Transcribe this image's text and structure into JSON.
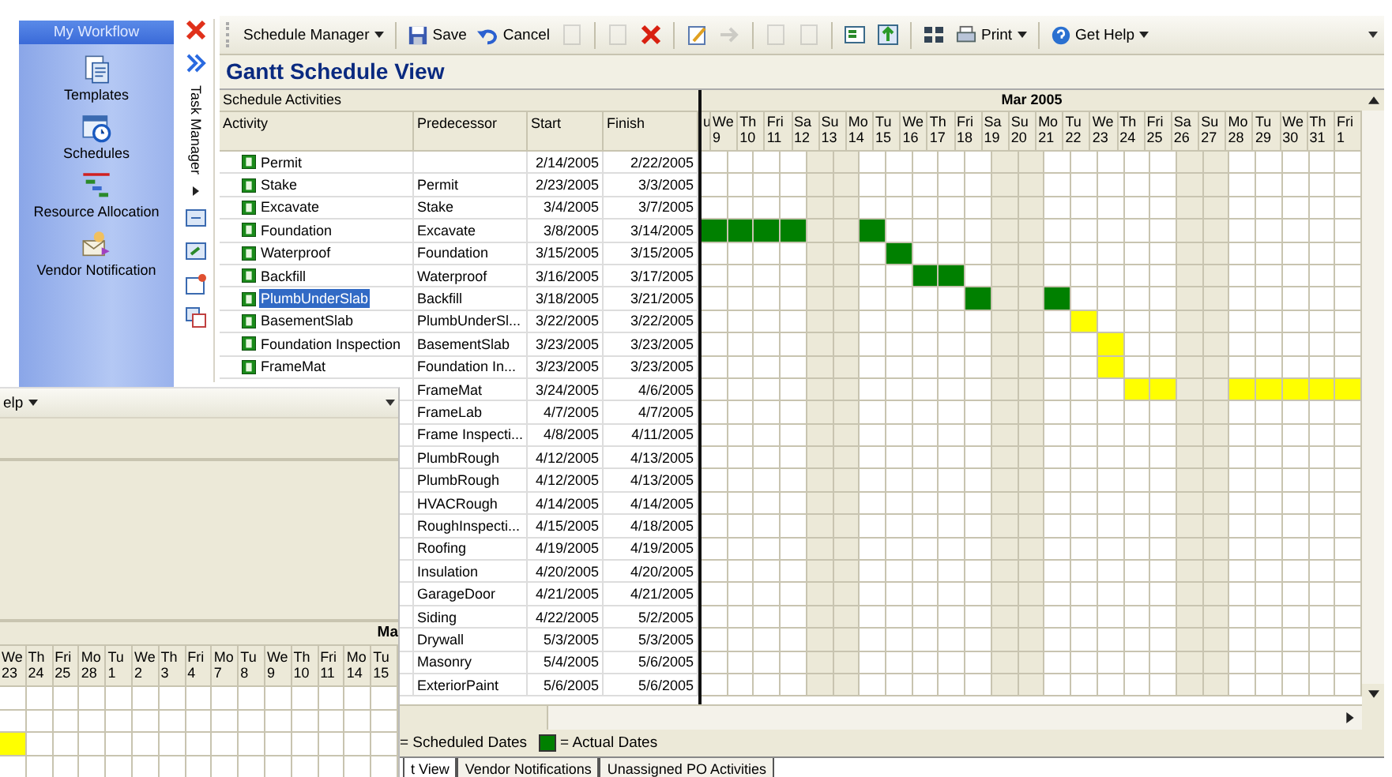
{
  "sidebar": {
    "title": "My Workflow",
    "items": [
      {
        "label": "Templates"
      },
      {
        "label": "Schedules"
      },
      {
        "label": "Resource Allocation"
      },
      {
        "label": "Vendor Notification"
      }
    ]
  },
  "task_strip": {
    "label": "Task Manager"
  },
  "toolbar": [
    {
      "kind": "menu",
      "label": "Schedule Manager"
    },
    {
      "kind": "sep"
    },
    {
      "kind": "button",
      "label": "Save",
      "disabled": false
    },
    {
      "kind": "button",
      "label": "Cancel",
      "disabled": false
    },
    {
      "kind": "icon",
      "disabled": true
    },
    {
      "kind": "sep"
    },
    {
      "kind": "icon",
      "disabled": true
    },
    {
      "kind": "icon",
      "disabled": false
    },
    {
      "kind": "sep"
    },
    {
      "kind": "icon",
      "disabled": false
    },
    {
      "kind": "icon",
      "disabled": true
    },
    {
      "kind": "sep"
    },
    {
      "kind": "icon",
      "disabled": true
    },
    {
      "kind": "icon",
      "disabled": true
    },
    {
      "kind": "sep"
    },
    {
      "kind": "icon",
      "disabled": false
    },
    {
      "kind": "icon",
      "disabled": false
    },
    {
      "kind": "sep"
    },
    {
      "kind": "icon",
      "disabled": false
    },
    {
      "kind": "menu",
      "label": "Print"
    },
    {
      "kind": "sep"
    },
    {
      "kind": "menu",
      "label": "Get Help"
    }
  ],
  "title": "Gantt Schedule View",
  "table": {
    "caption": "Schedule Activities",
    "columns": [
      "Activity",
      "Predecessor",
      "Start",
      "Finish"
    ],
    "rows": [
      {
        "activity": "Permit",
        "start": "2/14/2005",
        "finish": "2/22/2005",
        "selected": false
      },
      {
        "activity": "Stake",
        "predecessor": "Permit",
        "start": "2/23/2005",
        "finish": "3/3/2005",
        "selected": false
      },
      {
        "activity": "Excavate",
        "predecessor": "Stake",
        "start": "3/4/2005",
        "finish": "3/7/2005",
        "selected": false
      },
      {
        "activity": "Foundation",
        "predecessor": "Excavate",
        "start": "3/8/2005",
        "finish": "3/14/2005",
        "selected": false,
        "days": [
          {
            "kind": "actual"
          },
          {
            "kind": "actual"
          },
          {
            "kind": "actual"
          },
          {
            "kind": "actual"
          },
          {
            "kind": "empty"
          },
          {
            "kind": "empty"
          },
          {
            "kind": "actual"
          }
        ]
      },
      {
        "activity": "Waterproof",
        "predecessor": "Foundation",
        "start": "3/15/2005",
        "finish": "3/15/2005",
        "selected": false,
        "days": [
          {
            "kind": "empty"
          },
          {
            "kind": "empty"
          },
          {
            "kind": "empty"
          },
          {
            "kind": "empty"
          },
          {
            "kind": "empty"
          },
          {
            "kind": "empty"
          },
          {
            "kind": "empty"
          },
          {
            "kind": "actual"
          }
        ]
      },
      {
        "activity": "Backfill",
        "predecessor": "Waterproof",
        "start": "3/16/2005",
        "finish": "3/17/2005",
        "selected": false,
        "days": [
          {
            "kind": "empty"
          },
          {
            "kind": "empty"
          },
          {
            "kind": "empty"
          },
          {
            "kind": "empty"
          },
          {
            "kind": "empty"
          },
          {
            "kind": "empty"
          },
          {
            "kind": "empty"
          },
          {
            "kind": "empty"
          },
          {
            "kind": "actual"
          },
          {
            "kind": "actual"
          }
        ]
      },
      {
        "activity": "PlumbUnderSlab",
        "predecessor": "Backfill",
        "start": "3/18/2005",
        "finish": "3/21/2005",
        "selected": true,
        "days": [
          {
            "kind": "empty"
          },
          {
            "kind": "empty"
          },
          {
            "kind": "empty"
          },
          {
            "kind": "empty"
          },
          {
            "kind": "empty"
          },
          {
            "kind": "empty"
          },
          {
            "kind": "empty"
          },
          {
            "kind": "empty"
          },
          {
            "kind": "empty"
          },
          {
            "kind": "empty"
          },
          {
            "kind": "actual"
          },
          {
            "kind": "empty"
          },
          {
            "kind": "empty"
          },
          {
            "kind": "actual"
          }
        ]
      },
      {
        "activity": "BasementSlab",
        "predecessor": "PlumbUnderSl...",
        "start": "3/22/2005",
        "finish": "3/22/2005",
        "selected": false,
        "days": [
          {
            "kind": "empty"
          },
          {
            "kind": "empty"
          },
          {
            "kind": "empty"
          },
          {
            "kind": "empty"
          },
          {
            "kind": "empty"
          },
          {
            "kind": "empty"
          },
          {
            "kind": "empty"
          },
          {
            "kind": "empty"
          },
          {
            "kind": "empty"
          },
          {
            "kind": "empty"
          },
          {
            "kind": "empty"
          },
          {
            "kind": "empty"
          },
          {
            "kind": "empty"
          },
          {
            "kind": "empty"
          },
          {
            "kind": "scheduled"
          }
        ]
      },
      {
        "activity": "Foundation Inspection",
        "predecessor": "BasementSlab",
        "start": "3/23/2005",
        "finish": "3/23/2005",
        "selected": false,
        "days": [
          {
            "kind": "empty"
          },
          {
            "kind": "empty"
          },
          {
            "kind": "empty"
          },
          {
            "kind": "empty"
          },
          {
            "kind": "empty"
          },
          {
            "kind": "empty"
          },
          {
            "kind": "empty"
          },
          {
            "kind": "empty"
          },
          {
            "kind": "empty"
          },
          {
            "kind": "empty"
          },
          {
            "kind": "empty"
          },
          {
            "kind": "empty"
          },
          {
            "kind": "empty"
          },
          {
            "kind": "empty"
          },
          {
            "kind": "empty"
          },
          {
            "kind": "scheduled"
          }
        ]
      },
      {
        "activity": "FrameMat",
        "predecessor": "Foundation In...",
        "start": "3/23/2005",
        "finish": "3/23/2005",
        "selected": false,
        "days": [
          {
            "kind": "empty"
          },
          {
            "kind": "empty"
          },
          {
            "kind": "empty"
          },
          {
            "kind": "empty"
          },
          {
            "kind": "empty"
          },
          {
            "kind": "empty"
          },
          {
            "kind": "empty"
          },
          {
            "kind": "empty"
          },
          {
            "kind": "empty"
          },
          {
            "kind": "empty"
          },
          {
            "kind": "empty"
          },
          {
            "kind": "empty"
          },
          {
            "kind": "empty"
          },
          {
            "kind": "empty"
          },
          {
            "kind": "empty"
          },
          {
            "kind": "scheduled"
          }
        ]
      },
      {
        "predecessor": "FrameMat",
        "start": "3/24/2005",
        "finish": "4/6/2005",
        "days": [
          {
            "kind": "empty"
          },
          {
            "kind": "empty"
          },
          {
            "kind": "empty"
          },
          {
            "kind": "empty"
          },
          {
            "kind": "empty"
          },
          {
            "kind": "empty"
          },
          {
            "kind": "empty"
          },
          {
            "kind": "empty"
          },
          {
            "kind": "empty"
          },
          {
            "kind": "empty"
          },
          {
            "kind": "empty"
          },
          {
            "kind": "empty"
          },
          {
            "kind": "empty"
          },
          {
            "kind": "empty"
          },
          {
            "kind": "empty"
          },
          {
            "kind": "empty"
          },
          {
            "kind": "scheduled"
          },
          {
            "kind": "scheduled"
          },
          {
            "kind": "empty"
          },
          {
            "kind": "empty"
          },
          {
            "kind": "scheduled"
          },
          {
            "kind": "scheduled"
          },
          {
            "kind": "scheduled"
          },
          {
            "kind": "scheduled"
          },
          {
            "kind": "scheduled"
          }
        ]
      },
      {
        "predecessor": "FrameLab",
        "start": "4/7/2005",
        "finish": "4/7/2005"
      },
      {
        "predecessor": "Frame Inspecti...",
        "start": "4/8/2005",
        "finish": "4/11/2005"
      },
      {
        "predecessor": "PlumbRough",
        "start": "4/12/2005",
        "finish": "4/13/2005"
      },
      {
        "predecessor": "PlumbRough",
        "start": "4/12/2005",
        "finish": "4/13/2005"
      },
      {
        "predecessor": "HVACRough",
        "start": "4/14/2005",
        "finish": "4/14/2005"
      },
      {
        "predecessor": "RoughInspecti...",
        "start": "4/15/2005",
        "finish": "4/18/2005"
      },
      {
        "predecessor": "Roofing",
        "start": "4/19/2005",
        "finish": "4/19/2005"
      },
      {
        "predecessor": "Insulation",
        "start": "4/20/2005",
        "finish": "4/20/2005"
      },
      {
        "predecessor": "GarageDoor",
        "start": "4/21/2005",
        "finish": "4/21/2005"
      },
      {
        "predecessor": "Siding",
        "start": "4/22/2005",
        "finish": "5/2/2005"
      },
      {
        "predecessor": "Drywall",
        "start": "5/3/2005",
        "finish": "5/3/2005"
      },
      {
        "predecessor": "Masonry",
        "start": "5/4/2005",
        "finish": "5/6/2005"
      },
      {
        "predecessor": "ExteriorPaint",
        "start": "5/6/2005",
        "finish": "5/6/2005"
      }
    ]
  },
  "gantt": {
    "month": "Mar 2005",
    "days": [
      {
        "weekday": "u",
        "weekend": false
      },
      {
        "weekday": "We",
        "date": "9",
        "weekend": false
      },
      {
        "weekday": "Th",
        "date": "10",
        "weekend": false
      },
      {
        "weekday": "Fri",
        "date": "11",
        "weekend": false
      },
      {
        "weekday": "Sa",
        "date": "12",
        "weekend": true
      },
      {
        "weekday": "Su",
        "date": "13",
        "weekend": true
      },
      {
        "weekday": "Mo",
        "date": "14",
        "weekend": false
      },
      {
        "weekday": "Tu",
        "date": "15",
        "weekend": false
      },
      {
        "weekday": "We",
        "date": "16",
        "weekend": false
      },
      {
        "weekday": "Th",
        "date": "17",
        "weekend": false
      },
      {
        "weekday": "Fri",
        "date": "18",
        "weekend": false
      },
      {
        "weekday": "Sa",
        "date": "19",
        "weekend": true
      },
      {
        "weekday": "Su",
        "date": "20",
        "weekend": true
      },
      {
        "weekday": "Mo",
        "date": "21",
        "weekend": false
      },
      {
        "weekday": "Tu",
        "date": "22",
        "weekend": false
      },
      {
        "weekday": "We",
        "date": "23",
        "weekend": false
      },
      {
        "weekday": "Th",
        "date": "24",
        "weekend": false
      },
      {
        "weekday": "Fri",
        "date": "25",
        "weekend": false
      },
      {
        "weekday": "Sa",
        "date": "26",
        "weekend": true
      },
      {
        "weekday": "Su",
        "date": "27",
        "weekend": true
      },
      {
        "weekday": "Mo",
        "date": "28",
        "weekend": false
      },
      {
        "weekday": "Tu",
        "date": "29",
        "weekend": false
      },
      {
        "weekday": "We",
        "date": "30",
        "weekend": false
      },
      {
        "weekday": "Th",
        "date": "31",
        "weekend": false
      },
      {
        "weekday": "Fri",
        "date": "1",
        "weekend": false
      }
    ]
  },
  "legend": [
    {
      "text": "= Scheduled Dates"
    },
    {
      "color": "#008000",
      "text": "= Actual Dates"
    }
  ],
  "tabs": [
    {
      "label": "t View",
      "selected": true
    },
    {
      "label": "Vendor Notifications",
      "selected": false
    },
    {
      "label": "Unassigned PO Activities",
      "selected": false
    }
  ],
  "overlay_window": {
    "menu": "elp",
    "month": "Ma",
    "days": [
      {
        "weekday": "We",
        "date": "23"
      },
      {
        "weekday": "Th",
        "date": "24"
      },
      {
        "weekday": "Fri",
        "date": "25"
      },
      {
        "weekday": "Mo",
        "date": "28"
      },
      {
        "weekday": "Tu",
        "date": "1"
      },
      {
        "weekday": "We",
        "date": "2"
      },
      {
        "weekday": "Th",
        "date": "3"
      },
      {
        "weekday": "Fri",
        "date": "4"
      },
      {
        "weekday": "Mo",
        "date": "7"
      },
      {
        "weekday": "Tu",
        "date": "8"
      },
      {
        "weekday": "We",
        "date": "9"
      },
      {
        "weekday": "Th",
        "date": "10"
      },
      {
        "weekday": "Fri",
        "date": "11"
      },
      {
        "weekday": "Mo",
        "date": "14"
      },
      {
        "weekday": "Tu",
        "date": "15"
      }
    ],
    "rows": [
      {},
      {},
      {
        "days": [
          {
            "kind": "scheduled"
          }
        ]
      },
      {}
    ]
  }
}
